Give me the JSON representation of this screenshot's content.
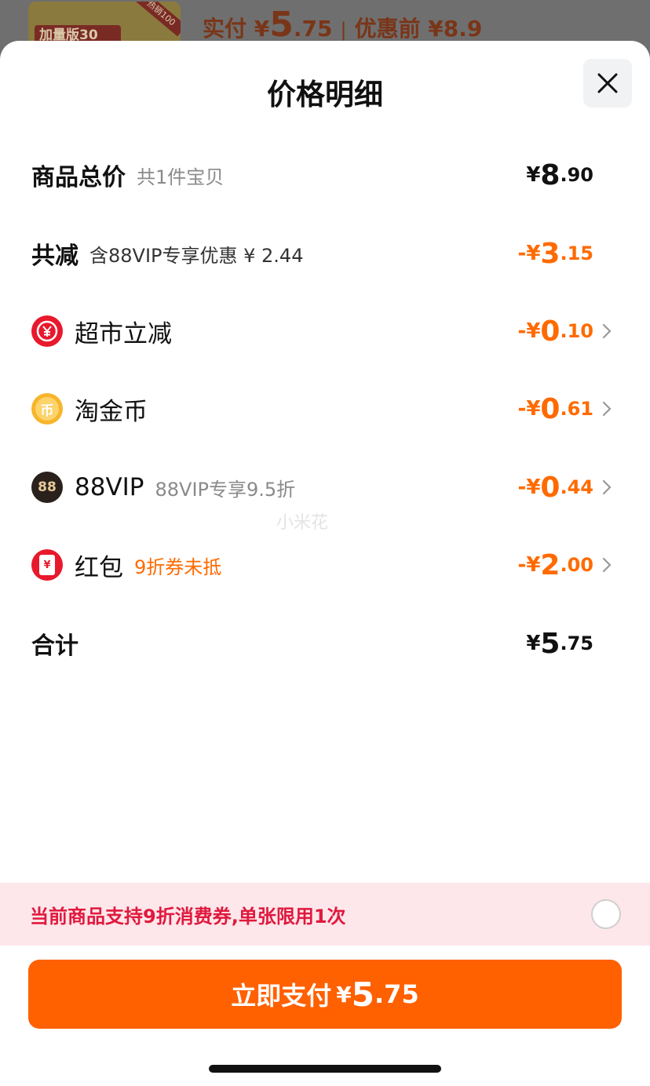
{
  "background": {
    "thumb_label": "加量版30",
    "thumb_ribbon": "热销100",
    "paid_label": "实付 ¥",
    "paid_int": "5",
    "paid_dec": ".75",
    "before_label": "优惠前 ¥8.9"
  },
  "sheet": {
    "title": "价格明细"
  },
  "rows": {
    "total": {
      "label": "商品总价",
      "sub": "共1件宝贝",
      "yen": "¥",
      "int": "8",
      "dec": ".90"
    },
    "reduction": {
      "label": "共减",
      "sub": "含88VIP专享优惠 ¥ 2.44",
      "yen": "-¥",
      "int": "3",
      "dec": ".15"
    },
    "supermarket": {
      "label": "超市立减",
      "yen": "-¥",
      "int": "0",
      "dec": ".10"
    },
    "coins": {
      "label": "淘金币",
      "yen": "-¥",
      "int": "0",
      "dec": ".61",
      "icon_glyph": "币"
    },
    "vip": {
      "label": "88VIP",
      "sub": "88VIP专享9.5折",
      "yen": "-¥",
      "int": "0",
      "dec": ".44",
      "icon_glyph": "88"
    },
    "redpacket": {
      "label": "红包",
      "sub": "9折券未抵",
      "yen": "-¥",
      "int": "2",
      "dec": ".00",
      "icon_glyph": "¥"
    },
    "sum": {
      "label": "合计",
      "yen": "¥",
      "int": "5",
      "dec": ".75"
    }
  },
  "watermark": "小米花",
  "coupon_bar": {
    "text": "当前商品支持9折消费券,单张限用1次"
  },
  "pay_button": {
    "label": "立即支付",
    "yen": "¥",
    "int": "5",
    "dec": ".75"
  },
  "colors": {
    "accent": "#ff6000",
    "discount": "#ff6a00",
    "coupon_text": "#e0193e",
    "coupon_bg": "#fde7ea"
  }
}
